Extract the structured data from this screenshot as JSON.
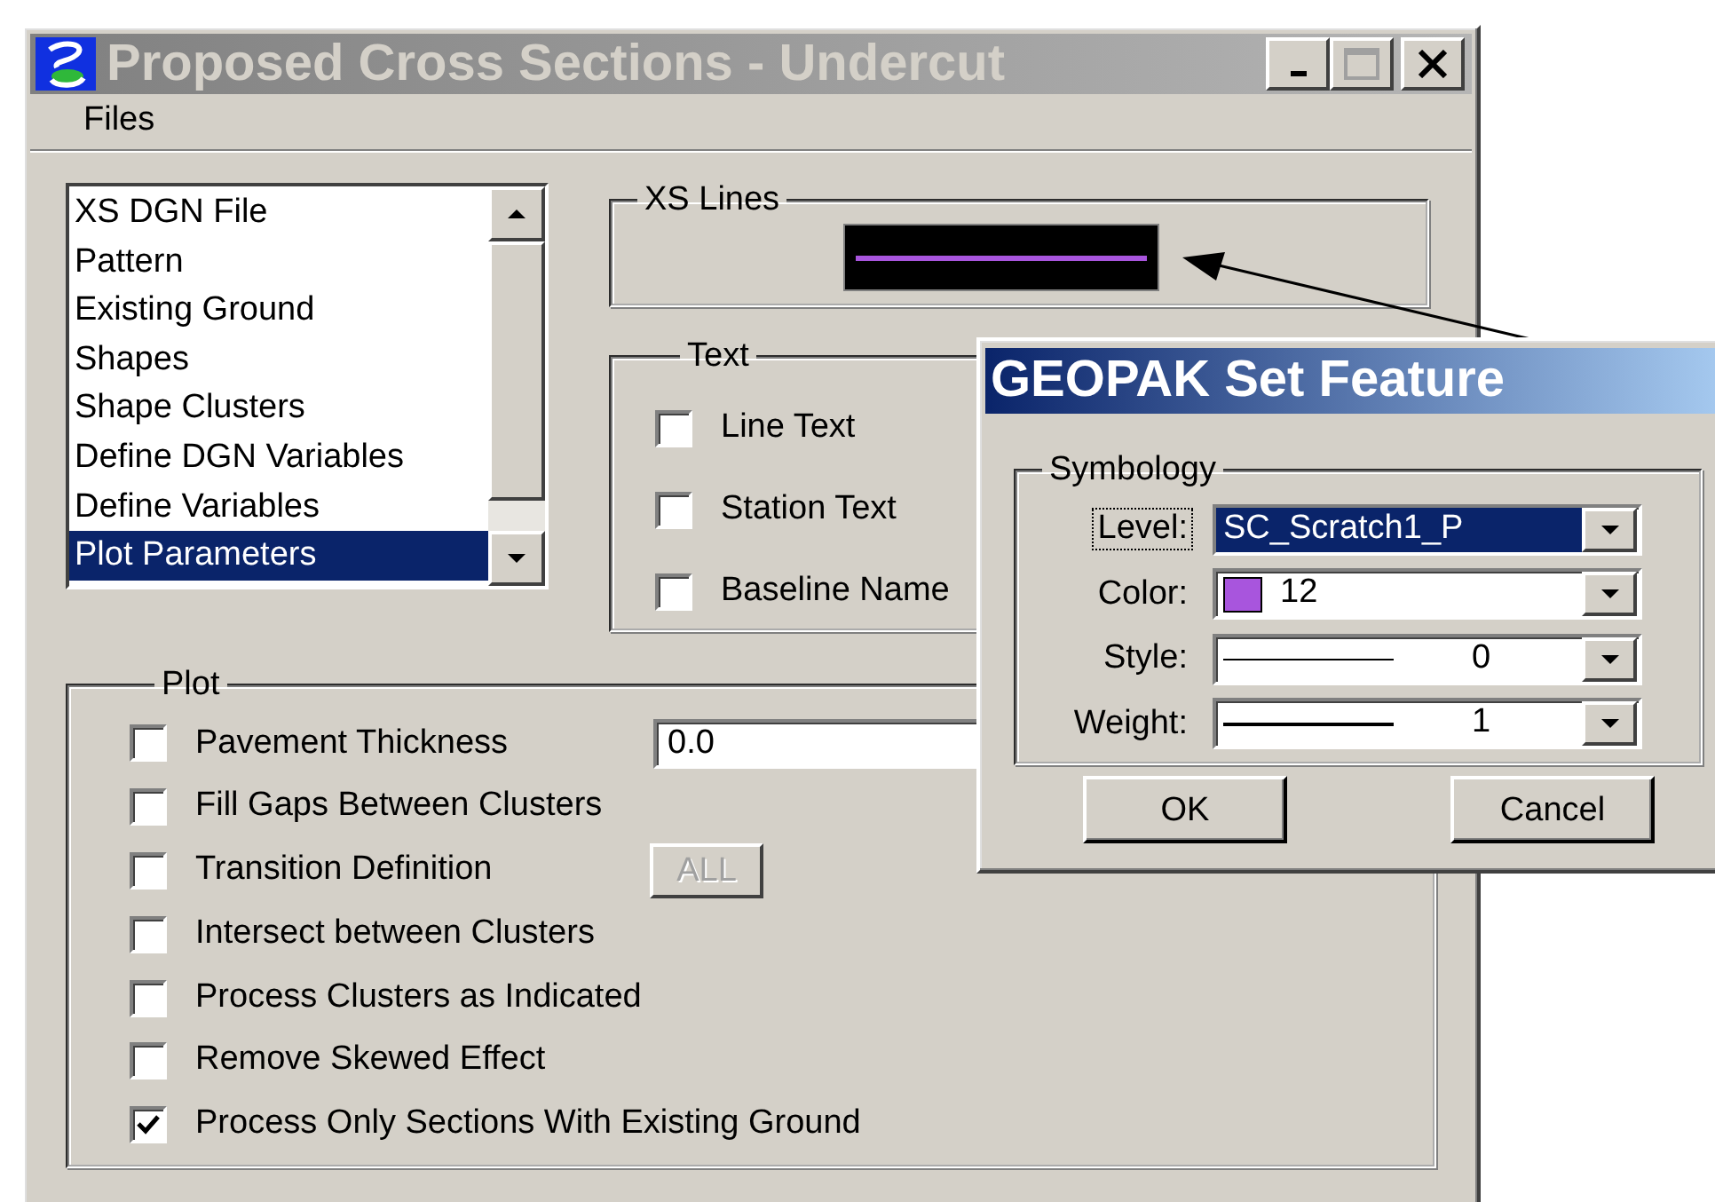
{
  "main_window": {
    "title": "Proposed Cross Sections - Undercut"
  },
  "menu": [
    {
      "label": "Files"
    }
  ],
  "list": {
    "items": [
      {
        "label": "XS DGN File",
        "selected": false
      },
      {
        "label": "Pattern",
        "selected": false
      },
      {
        "label": "Existing Ground",
        "selected": false
      },
      {
        "label": "Shapes",
        "selected": false
      },
      {
        "label": "Shape Clusters",
        "selected": false
      },
      {
        "label": "Define DGN Variables",
        "selected": false
      },
      {
        "label": "Define Variables",
        "selected": false
      },
      {
        "label": "Plot Parameters",
        "selected": true
      }
    ]
  },
  "xs_lines": {
    "title": "XS Lines"
  },
  "text_group": {
    "title": "Text",
    "options": [
      {
        "label": "Line Text",
        "checked": false
      },
      {
        "label": "Station Text",
        "checked": false
      },
      {
        "label": "Baseline Name",
        "checked": false
      }
    ]
  },
  "plot": {
    "title": "Plot",
    "options": [
      {
        "label": "Pavement Thickness",
        "checked": false,
        "kind": "field",
        "value": "0.0"
      },
      {
        "label": "Fill Gaps Between Clusters",
        "checked": false,
        "kind": "plain"
      },
      {
        "label": "Transition Definition",
        "checked": false,
        "kind": "button",
        "button": {
          "label": "ALL",
          "disabled": true
        }
      },
      {
        "label": "Intersect between Clusters",
        "checked": false,
        "kind": "plain"
      },
      {
        "label": "Process Clusters as Indicated",
        "checked": false,
        "kind": "plain"
      },
      {
        "label": "Remove Skewed Effect",
        "checked": false,
        "kind": "plain"
      },
      {
        "label": "Process Only Sections With Existing Ground",
        "checked": true,
        "kind": "plain"
      }
    ]
  },
  "dialog": {
    "title": "GEOPAK Set Feature",
    "group": "Symbology",
    "fields": [
      {
        "label": "Level:",
        "value": "SC_Scratch1_P",
        "kind": "text",
        "selected": true,
        "focused": true
      },
      {
        "label": "Color:",
        "value": "12",
        "kind": "color",
        "color": "#a855dd",
        "selected": false,
        "focused": false
      },
      {
        "label": "Style:",
        "value": "0",
        "kind": "line",
        "selected": false,
        "focused": false
      },
      {
        "label": "Weight:",
        "value": "1",
        "kind": "line",
        "selected": false,
        "focused": false
      }
    ],
    "buttons": [
      "OK",
      "Cancel"
    ]
  }
}
